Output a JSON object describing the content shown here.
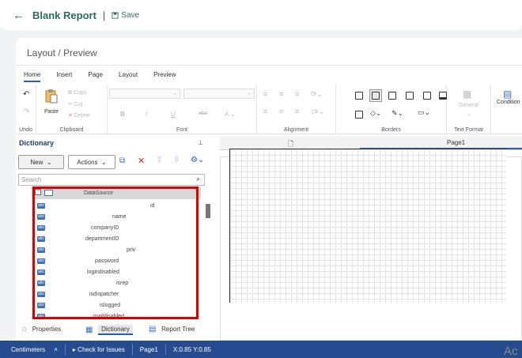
{
  "header": {
    "title": "Blank Report",
    "separator": "|",
    "save_label": "Save"
  },
  "panel_title": "Layout / Preview",
  "menu_tabs": [
    "Home",
    "Insert",
    "Page",
    "Layout",
    "Preview"
  ],
  "ribbon": {
    "undo": "Undo",
    "paste": "Paste",
    "copy": "Copy",
    "cut": "Cut",
    "delete": "Delete",
    "clipboard": "Clipboard",
    "font": "Font",
    "alignment": "Alignment",
    "borders": "Borders",
    "general": "General",
    "text_format": "Text Format",
    "conditions": "Condition"
  },
  "dictionary": {
    "title": "Dictionary",
    "new_label": "New",
    "actions_label": "Actions",
    "search_placeholder": "Search",
    "datasource": "DataSource",
    "fields": [
      "id",
      "name",
      "companyID",
      "departmentID",
      "priv",
      "password",
      "logindisabled",
      "isrep",
      "isdispatcher",
      "islogged",
      "maildisabled"
    ]
  },
  "bottom_tabs": {
    "properties": "Properties",
    "dictionary": "Dictionary",
    "report_tree": "Report Tree"
  },
  "page_tab": "Page1",
  "status": {
    "units": "Centimeters",
    "check": "Check for Issues",
    "page": "Page1",
    "coords": "X:0.85 Y:0.85"
  },
  "watermark": "Ac"
}
